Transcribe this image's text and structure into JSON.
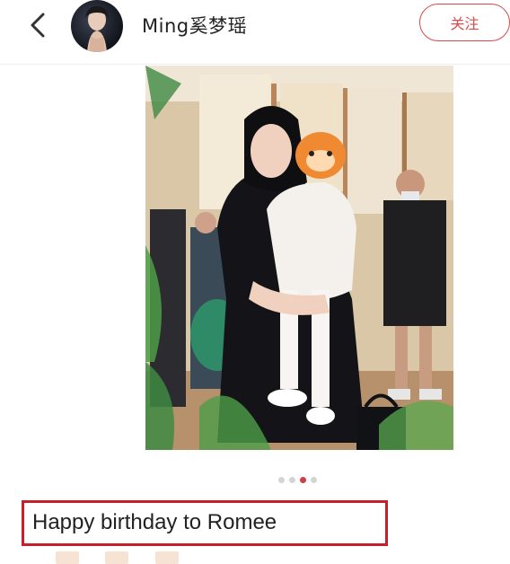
{
  "header": {
    "back_icon": "chevron-left-icon",
    "username": "Ming奚梦瑶",
    "follow_label": "关注",
    "accent_color": "#d94a4a"
  },
  "post": {
    "photo_description_icon": "photo",
    "carousel": {
      "total": 4,
      "active_index": 2
    },
    "caption": "Happy birthday to Romee"
  },
  "highlight_color": "#c8202a"
}
